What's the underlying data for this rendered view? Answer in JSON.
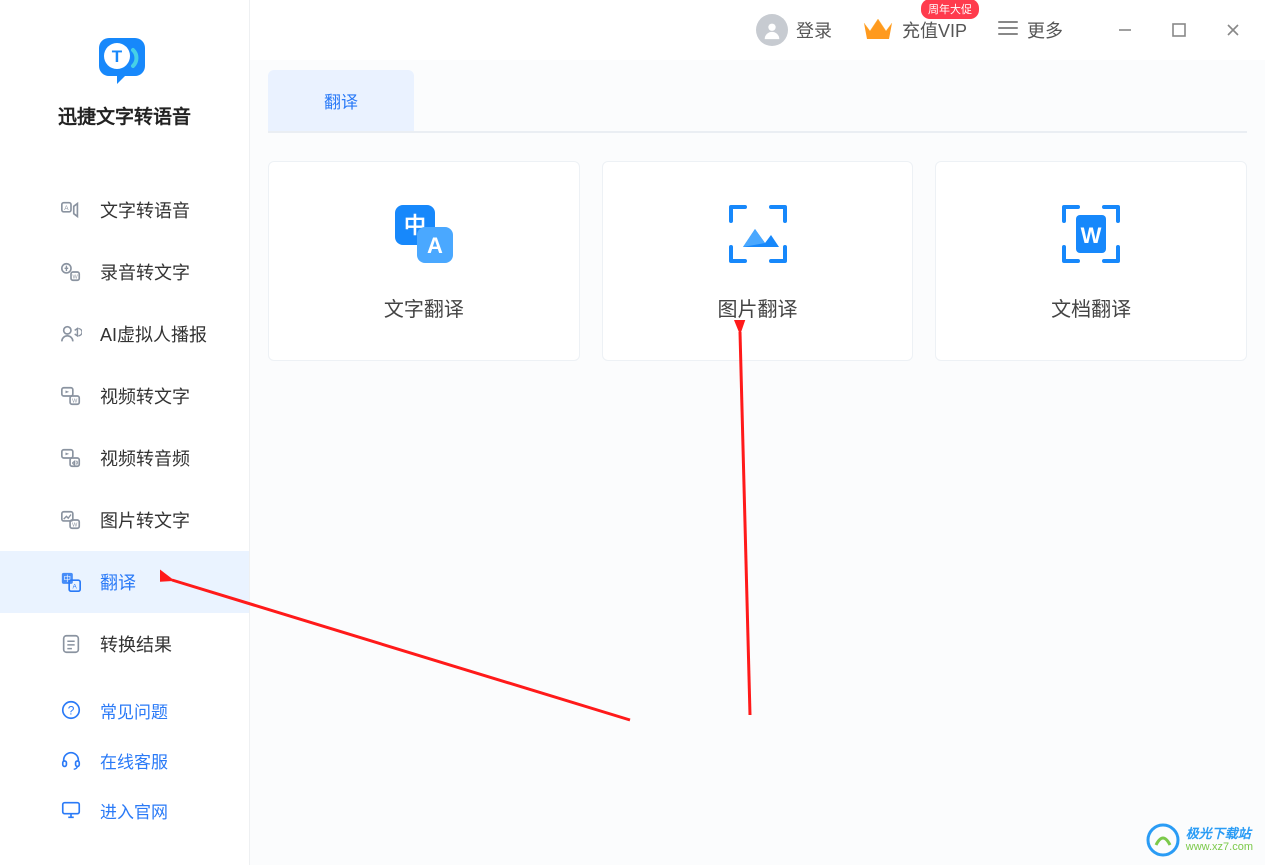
{
  "app": {
    "title": "迅捷文字转语音"
  },
  "sidebar": {
    "items": [
      {
        "label": "文字转语音",
        "icon": "text-to-speech"
      },
      {
        "label": "录音转文字",
        "icon": "audio-to-text"
      },
      {
        "label": "AI虚拟人播报",
        "icon": "ai-avatar"
      },
      {
        "label": "视频转文字",
        "icon": "video-to-text"
      },
      {
        "label": "视频转音频",
        "icon": "video-to-audio"
      },
      {
        "label": "图片转文字",
        "icon": "image-to-text"
      },
      {
        "label": "翻译",
        "icon": "translate"
      },
      {
        "label": "转换结果",
        "icon": "results"
      }
    ],
    "active_index": 6
  },
  "bottom_links": {
    "faq": "常见问题",
    "support": "在线客服",
    "website": "进入官网"
  },
  "header": {
    "login": "登录",
    "vip": "充值VIP",
    "vip_badge": "周年大促",
    "more": "更多"
  },
  "tabs": {
    "active": "翻译"
  },
  "cards": [
    {
      "label": "文字翻译",
      "icon": "text-translate"
    },
    {
      "label": "图片翻译",
      "icon": "image-translate"
    },
    {
      "label": "文档翻译",
      "icon": "doc-translate"
    }
  ],
  "watermark": {
    "title": "极光下载站",
    "url": "www.xz7.com"
  }
}
